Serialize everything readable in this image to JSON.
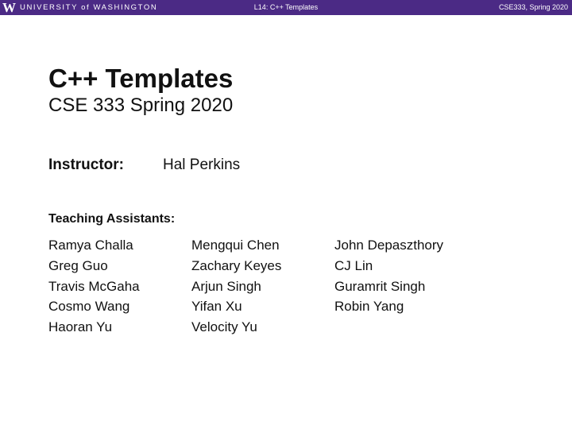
{
  "header": {
    "logo_mark": "W",
    "university": "UNIVERSITY of WASHINGTON",
    "lecture": "L14: C++ Templates",
    "course": "CSE333, Spring 2020"
  },
  "slide": {
    "title": "C++ Templates",
    "subtitle": "CSE 333 Spring 2020",
    "instructor_label": "Instructor:",
    "instructor_name": "Hal Perkins",
    "ta_label": "Teaching Assistants:",
    "ta_columns": [
      [
        "Ramya Challa",
        "Greg Guo",
        "Travis McGaha",
        "Cosmo Wang",
        "Haoran Yu"
      ],
      [
        "Mengqui Chen",
        "Zachary Keyes",
        "Arjun Singh",
        "Yifan Xu",
        "Velocity Yu"
      ],
      [
        "John Depaszthory",
        "CJ Lin",
        "Guramrit Singh",
        "Robin Yang"
      ]
    ]
  },
  "colors": {
    "header_bg": "#4b2a85",
    "header_text": "#ffffff",
    "body_text": "#111111"
  }
}
